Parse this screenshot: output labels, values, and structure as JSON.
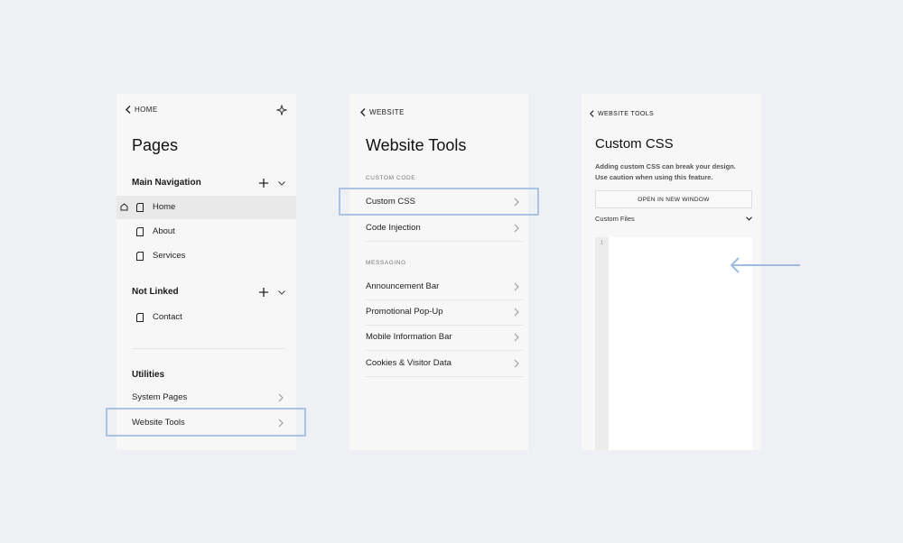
{
  "panel1": {
    "back_label": "HOME",
    "title": "Pages",
    "main_nav": {
      "label": "Main Navigation",
      "items": [
        "Home",
        "About",
        "Services"
      ]
    },
    "not_linked": {
      "label": "Not Linked",
      "items": [
        "Contact"
      ]
    },
    "utilities": {
      "label": "Utilities",
      "items": [
        "System Pages",
        "Website Tools"
      ]
    }
  },
  "panel2": {
    "back_label": "WEBSITE",
    "title": "Website Tools",
    "custom_code_label": "CUSTOM CODE",
    "custom_code_items": [
      "Custom CSS",
      "Code Injection"
    ],
    "messaging_label": "MESSAGING",
    "messaging_items": [
      "Announcement Bar",
      "Promotional Pop-Up",
      "Mobile Information Bar",
      "Cookies & Visitor Data"
    ]
  },
  "panel3": {
    "back_label": "WEBSITE TOOLS",
    "title": "Custom CSS",
    "warning_line1": "Adding custom CSS can break your design.",
    "warning_line2": "Use caution when using this feature.",
    "open_button": "OPEN IN NEW WINDOW",
    "custom_files_label": "Custom Files",
    "line_number": "1"
  },
  "colors": {
    "background": "#eef0f4",
    "panel": "#f7f7f7",
    "highlight": "#aac3e3",
    "arrow": "#9fbce0",
    "selected_row": "#e9e9e9"
  }
}
